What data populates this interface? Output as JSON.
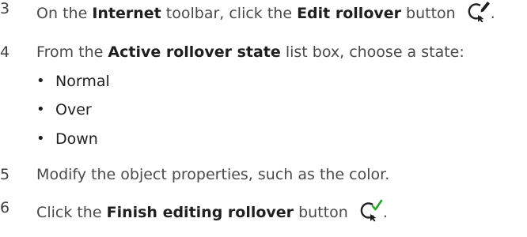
{
  "steps": [
    {
      "number": "3",
      "parts": [
        "On the ",
        "Internet",
        " toolbar, click the ",
        "Edit rollover",
        " button",
        "."
      ],
      "icon": "edit-rollover-icon"
    },
    {
      "number": "4",
      "parts": [
        "From the ",
        "Active rollover state",
        " list box, choose a state:"
      ],
      "bullets": [
        "Normal",
        "Over",
        "Down"
      ]
    },
    {
      "number": "5",
      "parts": [
        "Modify the object properties, such as the color."
      ]
    },
    {
      "number": "6",
      "parts": [
        "Click the ",
        "Finish editing rollover",
        " button",
        "."
      ],
      "icon": "finish-editing-rollover-icon"
    }
  ],
  "colors": {
    "text": "#4a4a4a",
    "bold": "#1f1f1f",
    "check_green": "#2aa52a"
  }
}
